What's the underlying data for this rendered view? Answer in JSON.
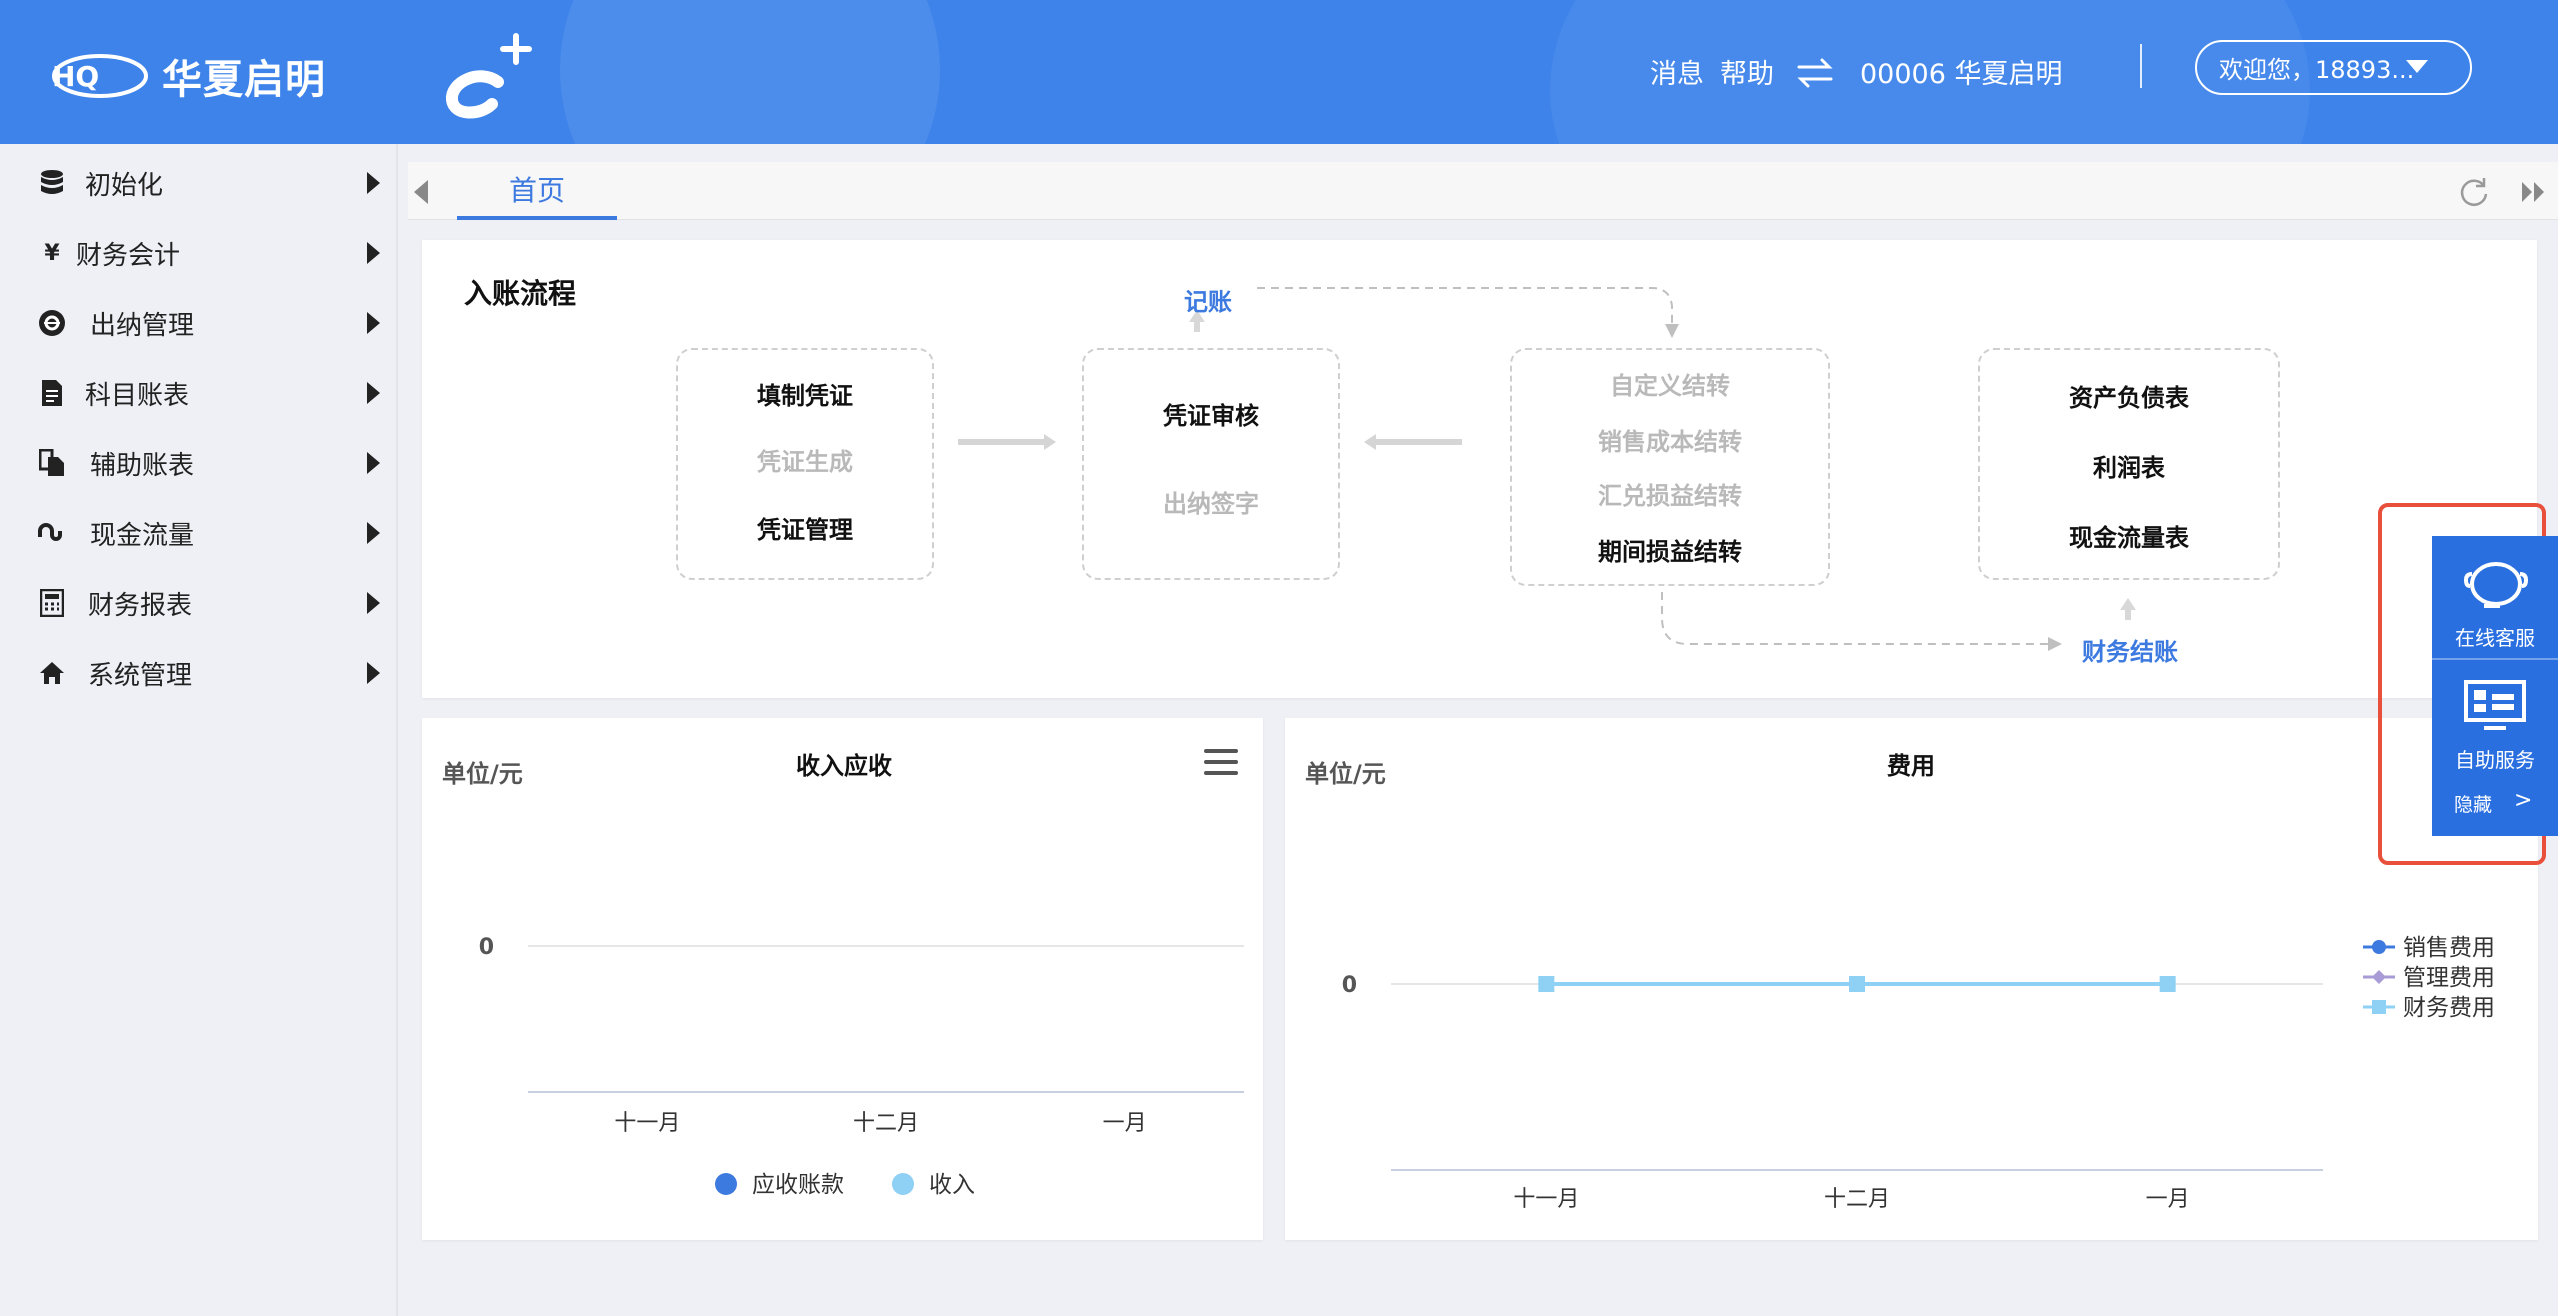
{
  "header": {
    "brand_name": "华夏启明",
    "brand_mark_text": "HQ",
    "links": [
      "消息",
      "帮助"
    ],
    "company": "00006 华夏启明",
    "user_greeting": "欢迎您，18893..."
  },
  "sidebar": {
    "items": [
      {
        "label": "初始化",
        "icon": "database-icon"
      },
      {
        "label": "财务会计",
        "icon": "yen-icon"
      },
      {
        "label": "出纳管理",
        "icon": "cashier-icon"
      },
      {
        "label": "科目账表",
        "icon": "document-icon"
      },
      {
        "label": "辅助账表",
        "icon": "copy-icon"
      },
      {
        "label": "现金流量",
        "icon": "stumbleupon-icon"
      },
      {
        "label": "财务报表",
        "icon": "calculator-icon"
      },
      {
        "label": "系统管理",
        "icon": "home-icon"
      }
    ]
  },
  "tabs": {
    "home": "首页"
  },
  "flow": {
    "title": "入账流程",
    "bookkeeping": "记账",
    "closing": "财务结账",
    "box1": [
      "填制凭证",
      "凭证生成",
      "凭证管理"
    ],
    "box2": [
      "凭证审核",
      "出纳签字"
    ],
    "box3": [
      "自定义结转",
      "销售成本结转",
      "汇兑损益结转",
      "期间损益结转"
    ],
    "box4": [
      "资产负债表",
      "利润表",
      "现金流量表"
    ]
  },
  "charts": {
    "unit": "单位/元",
    "income_title": "收入应收",
    "expense_title": "费用",
    "zero": "0"
  },
  "chart_data": [
    {
      "type": "line",
      "title": "收入应收",
      "ylabel": "单位/元",
      "categories": [
        "十一月",
        "十二月",
        "一月"
      ],
      "series": [
        {
          "name": "应收账款",
          "values": [
            0,
            0,
            0
          ],
          "color": "#3d7ae0"
        },
        {
          "name": "收入",
          "values": [
            0,
            0,
            0
          ],
          "color": "#8fd0f5"
        }
      ],
      "legend": "bottom"
    },
    {
      "type": "line",
      "title": "费用",
      "ylabel": "单位/元",
      "categories": [
        "十一月",
        "十二月",
        "一月"
      ],
      "series": [
        {
          "name": "销售费用",
          "values": [
            0,
            0,
            0
          ],
          "color": "#3d7ae0"
        },
        {
          "name": "管理费用",
          "values": [
            0,
            0,
            0
          ],
          "color": "#a99bd6"
        },
        {
          "name": "财务费用",
          "values": [
            0,
            0,
            0
          ],
          "color": "#8fd0f5"
        }
      ],
      "legend": "right"
    }
  ],
  "service": {
    "online": "在线客服",
    "self": "自助服务",
    "hide": "隐藏"
  }
}
